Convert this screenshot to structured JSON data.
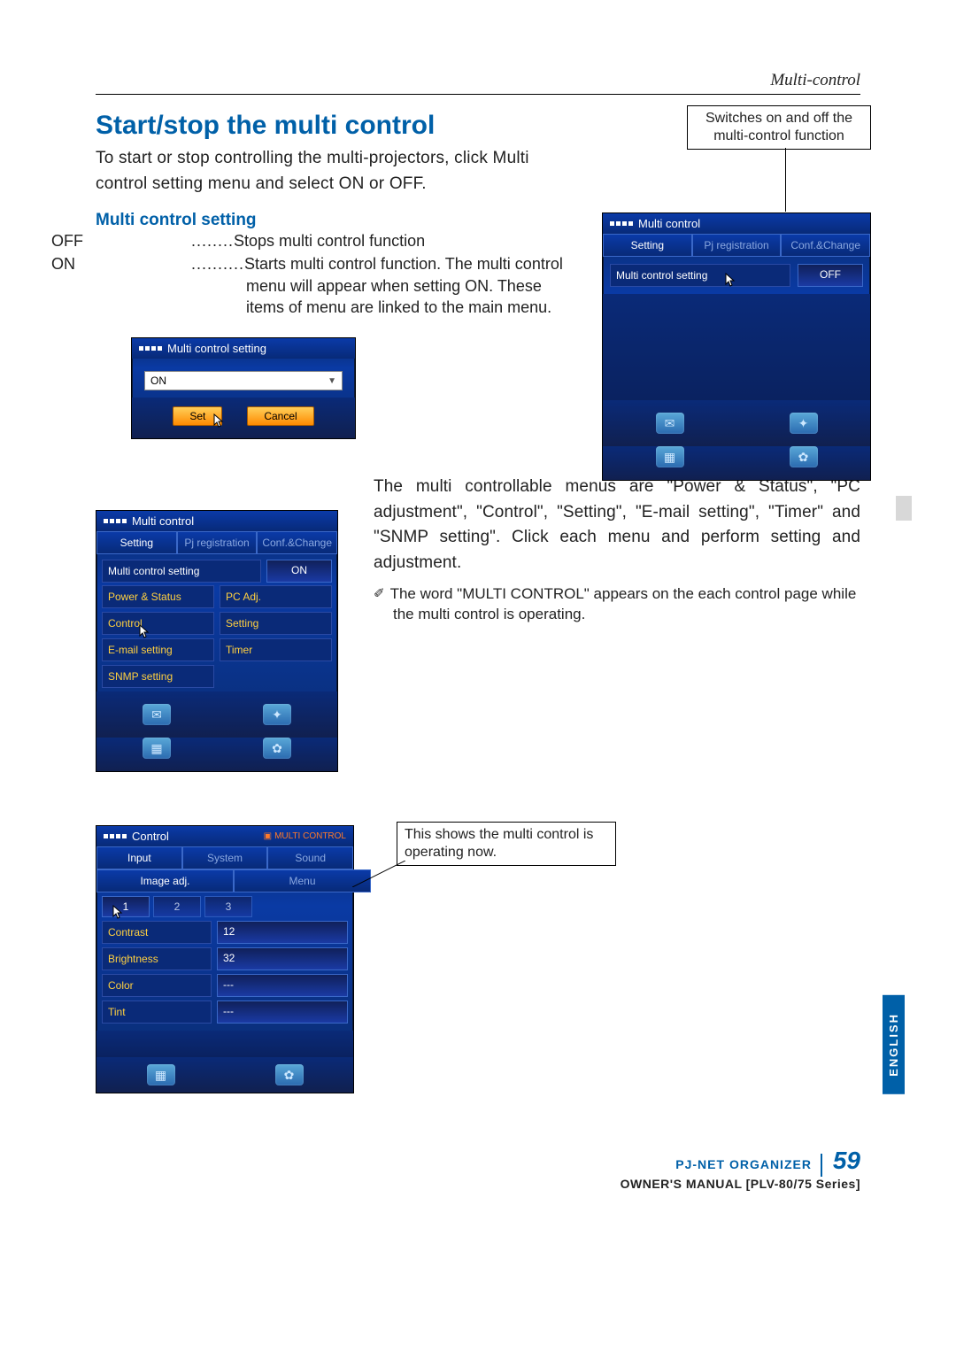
{
  "header": {
    "running": "Multi-control"
  },
  "section": {
    "title": "Start/stop the multi control",
    "intro": "To start or stop controlling the multi-projectors, click Multi control setting menu and select ON or OFF.",
    "sub": "Multi control setting",
    "off_term": "OFF",
    "off_dots": "........",
    "off_desc": "Stops multi control function",
    "on_term": "ON",
    "on_dots": "..........",
    "on_desc": "Starts multi control function. The multi control menu will appear when setting ON. These items of menu are linked to the main menu."
  },
  "callouts": {
    "c1": "Switches on and off the multi-control function",
    "c2": "This shows the multi control is operating now."
  },
  "shot1": {
    "title": "Multi control",
    "tabs": [
      "Setting",
      "Pj registration",
      "Conf.&Change"
    ],
    "row_label": "Multi control setting",
    "row_value": "OFF"
  },
  "shot2": {
    "title": "Multi control setting",
    "value": "ON",
    "set": "Set",
    "cancel": "Cancel"
  },
  "shot3": {
    "title": "Multi control",
    "tabs": [
      "Setting",
      "Pj registration",
      "Conf.&Change"
    ],
    "row_label": "Multi control setting",
    "row_value": "ON",
    "menus": [
      [
        "Power & Status",
        "PC Adj."
      ],
      [
        "Control",
        "Setting"
      ],
      [
        "E-mail setting",
        "Timer"
      ],
      [
        "SNMP setting",
        ""
      ]
    ]
  },
  "shot4": {
    "title": "Control",
    "badge": "MULTI CONTROL",
    "tabs": [
      "Input",
      "System",
      "Sound"
    ],
    "tabs2": [
      "Image adj.",
      "Menu"
    ],
    "pages": [
      "1",
      "2",
      "3"
    ],
    "rows": [
      {
        "label": "Contrast",
        "value": "12"
      },
      {
        "label": "Brightness",
        "value": "32"
      },
      {
        "label": "Color",
        "value": "---"
      },
      {
        "label": "Tint",
        "value": "---"
      }
    ]
  },
  "para2": "The multi controllable menus are \"Power & Status\", \"PC adjustment\", \"Control\", \"Setting\", \"E-mail setting\", \"Timer\" and \"SNMP setting\". Click each menu and perform setting and adjustment.",
  "note": "The word \"MULTI CONTROL\" appears on the each control page while the multi control is operating.",
  "footer": {
    "brand": "PJ-NET ORGANIZER",
    "page": "59",
    "sub": "OWNER'S MANUAL [PLV-80/75 Series]"
  },
  "side": "ENGLISH"
}
